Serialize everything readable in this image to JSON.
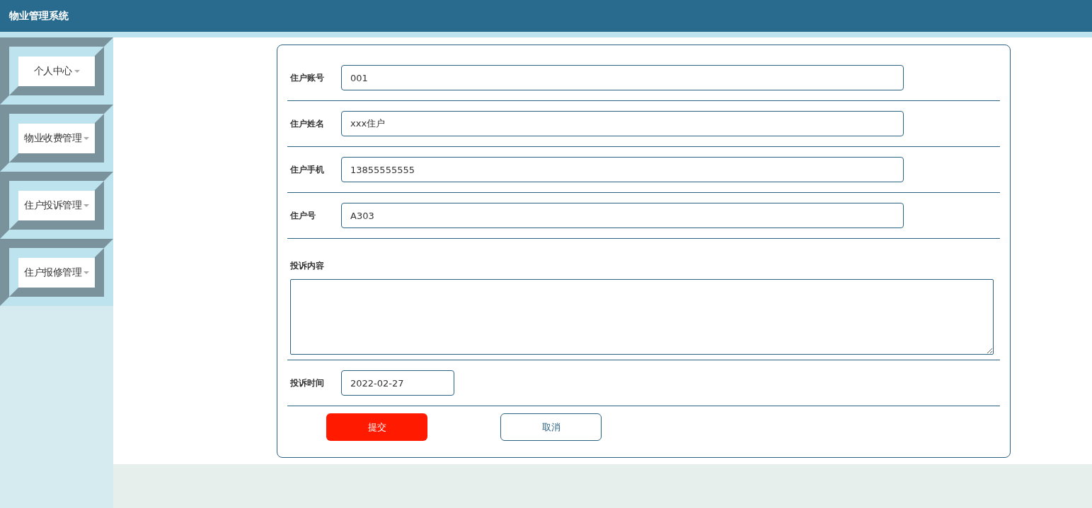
{
  "header": {
    "title": "物业管理系统"
  },
  "sidebar": {
    "items": [
      {
        "label": "个人中心"
      },
      {
        "label": "物业收费管理"
      },
      {
        "label": "住户投诉管理"
      },
      {
        "label": "住户报修管理"
      }
    ]
  },
  "form": {
    "fields": [
      {
        "kind": "input",
        "label": "住户账号",
        "value": "001"
      },
      {
        "kind": "input",
        "label": "住户姓名",
        "value": "xxx住户"
      },
      {
        "kind": "input",
        "label": "住户手机",
        "value": "13855555555"
      },
      {
        "kind": "input",
        "label": "住户号",
        "value": "A303"
      },
      {
        "kind": "textarea",
        "label": "投诉内容"
      },
      {
        "kind": "date",
        "label": "投诉时间",
        "value": "2022-02-27"
      }
    ],
    "buttons": [
      {
        "kind": "primary",
        "label": "提交"
      },
      {
        "kind": "secondary",
        "label": "取消"
      }
    ]
  }
}
